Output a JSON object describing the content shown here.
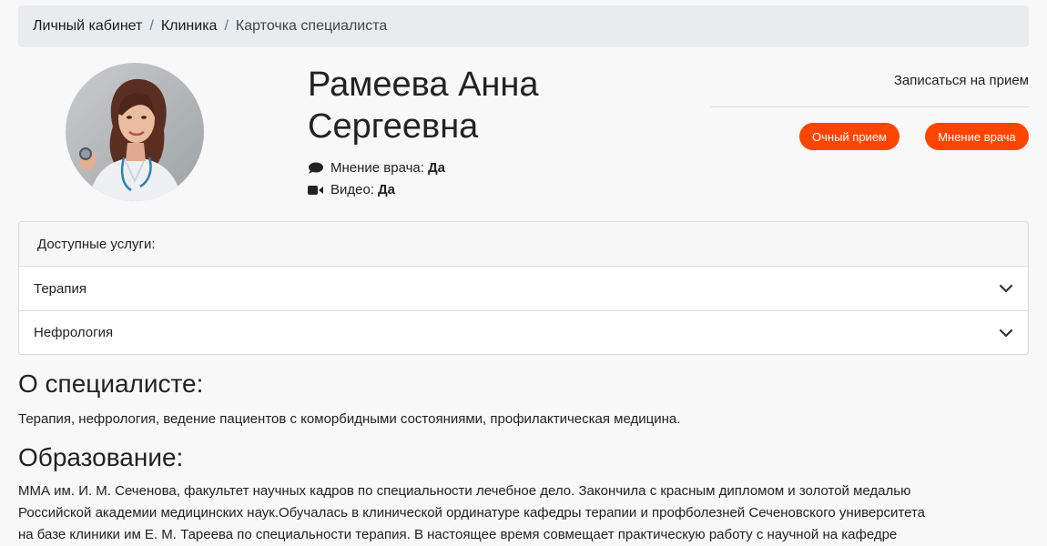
{
  "breadcrumb": {
    "items": [
      "Личный кабинет",
      "Клиника"
    ],
    "separator": "/",
    "current": "Карточка специалиста"
  },
  "doctor": {
    "name_line1": "Рамеева Анна",
    "name_line2": "Сергеевна",
    "avatar_icon": "doctor-photo",
    "opinion_label": "Мнение врача:",
    "opinion_value": "Да",
    "video_label": "Видео:",
    "video_value": "Да"
  },
  "booking": {
    "title": "Записаться на прием",
    "in_person_label": "Очный прием",
    "opinion_label": "Мнение врача",
    "accent_color": "#ff4500"
  },
  "services": {
    "header": "Доступные услуги:",
    "items": [
      "Терапия",
      "Нефрология"
    ]
  },
  "about": {
    "title": "О специалисте:",
    "text": "Терапия, нефрология, ведение пациентов с коморбидными состояниями, профилактическая медицина."
  },
  "education": {
    "title": "Образование:",
    "line1": "ММА им. И. М. Сеченова, факультет научных кадров по специальности лечебное дело. Закончила с красным дипломом и золотой медалью",
    "line2": "Российской академии медицинских наук.Обучалась в клинической ординатуре кафедры терапии и профболезней Сеченовского университета",
    "line3": "на базе клиники им Е. М. Тареева по специальности терапия. В настоящее время совмещает практическую работу с научной на кафедре"
  }
}
